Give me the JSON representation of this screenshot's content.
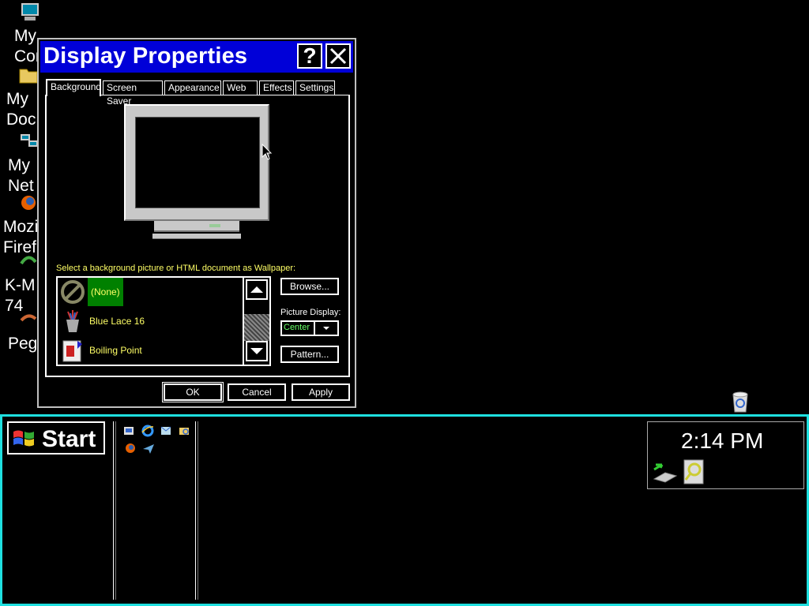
{
  "desktop": {
    "icons": [
      {
        "label": "My\nCom",
        "icon": "my-computer-icon"
      },
      {
        "label": "My\nDoc",
        "icon": "my-documents-icon"
      },
      {
        "label": "My\nNet",
        "icon": "my-network-icon"
      },
      {
        "label": "Mozi\nFiref",
        "icon": "firefox-icon"
      },
      {
        "label": "K-M\n74",
        "icon": "k-meleon-icon"
      },
      {
        "label": "Peg",
        "icon": "pegasus-icon"
      }
    ]
  },
  "window": {
    "title": "Display Properties",
    "help_label": "?",
    "close_label": "✕",
    "tabs": [
      "Background",
      "Screen Saver",
      "Appearance",
      "Web",
      "Effects",
      "Settings"
    ],
    "active_tab": "Background",
    "instruction": "Select a background picture or HTML document as Wallpaper:",
    "wallpapers": [
      {
        "name": "(None)",
        "icon": "none-icon",
        "selected": true
      },
      {
        "name": "Blue Lace 16",
        "icon": "wallpaper-icon",
        "selected": false
      },
      {
        "name": "Boiling Point",
        "icon": "html-document-icon",
        "selected": false
      }
    ],
    "browse_label": "Browse...",
    "picture_display_label": "Picture Display:",
    "picture_display_value": "Center",
    "pattern_label": "Pattern...",
    "ok_label": "OK",
    "cancel_label": "Cancel",
    "apply_label": "Apply"
  },
  "taskbar": {
    "start_label": "Start",
    "clock": "2:14 PM",
    "accent_color": "#1ee0e0"
  }
}
